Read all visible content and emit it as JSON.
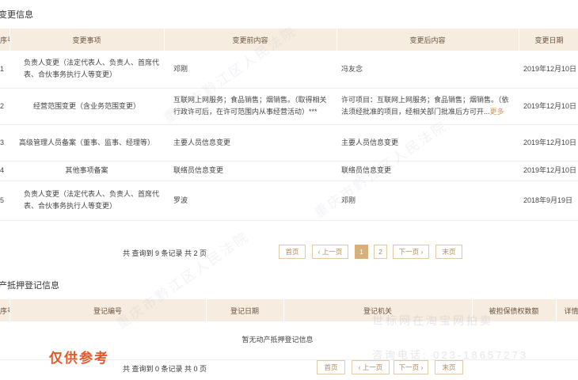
{
  "change_section": {
    "title": "变更信息",
    "headers": [
      "序号",
      "变更事项",
      "变更前内容",
      "变更后内容",
      "变更日期"
    ],
    "rows": [
      {
        "no": "1",
        "item": "负责人变更（法定代表人、负责人、首席代表、合伙事务执行人等变更）",
        "before": "邓刚",
        "after": "冯友念",
        "date": "2019年12月10日",
        "more": ""
      },
      {
        "no": "2",
        "item": "经营范围变更（含业务范围变更）",
        "before": "互联网上网服务；食品销售；烟销售。（取得相关行政许可后，在许可范围内从事经营活动）***",
        "after": "许可项目：互联网上网服务；食品销售；烟销售。（依法须经批准的项目，经相关部门批准后方可开...",
        "date": "2019年12月10日",
        "more": "更多"
      },
      {
        "no": "3",
        "item": "高级管理人员备案（董事、监事、经理等）",
        "before": "主要人员信息变更",
        "after": "主要人员信息变更",
        "date": "2019年12月10日",
        "more": ""
      },
      {
        "no": "4",
        "item": "其他事项备案",
        "before": "联络员信息变更",
        "after": "联络员信息变更",
        "date": "2019年12月10日",
        "more": ""
      },
      {
        "no": "5",
        "item": "负责人变更（法定代表人、负责人、首席代表、合伙事务执行人等变更）",
        "before": "罗波",
        "after": "邓刚",
        "date": "2018年9月19日",
        "more": ""
      }
    ],
    "pager": {
      "total": "共 查询到 9 条记录 共 2 页",
      "first": "首页",
      "prev": "‹ 上一页",
      "pages": [
        "1",
        "2"
      ],
      "next": "下一页 ›",
      "last": "末页"
    }
  },
  "mortgage_section": {
    "title": "动产抵押登记信息",
    "headers": [
      "序号",
      "登记编号",
      "登记日期",
      "登记机关",
      "被担保债权数额",
      "详情"
    ],
    "empty_text": "暂无动产抵押登记信息",
    "pager": {
      "total": "共 查询到 0 条记录 共 0 页",
      "first": "首页",
      "prev": "‹ 上一页",
      "next": "下一页 ›",
      "last": "末页"
    }
  },
  "stamp_text": "仅供参考",
  "watermark_texts": [
    "重庆市黔江区人民法院",
    "重庆市黔江区人民法院",
    "重庆市黔江区人民法院",
    "世标网在淘宝网拍卖",
    "咨询电话: 023-18657273"
  ]
}
